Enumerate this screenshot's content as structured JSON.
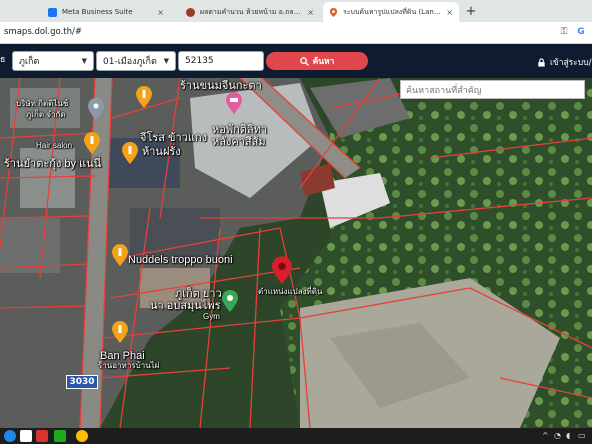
{
  "browser": {
    "tabs": [
      {
        "title": "Meta Business Suite",
        "active": false,
        "favicon_color": "#1877f2"
      },
      {
        "title": "ผลตามคำนวน ห้วยหน้าม อ.ถลาง จ.ภูเก็ต",
        "active": false,
        "favicon_color": "#9b3b2a"
      },
      {
        "title": "ระบบค้นหารูปแปลงที่ดิน (LandsMaps)",
        "active": true,
        "favicon_color": "#e05a2b"
      }
    ],
    "new_tab_label": "+",
    "close_glyph": "×",
    "url": "smaps.dol.go.th/#",
    "address_icons": [
      "key-icon",
      "google-icon"
    ]
  },
  "toolbar": {
    "left_edge_text": "ัธ",
    "province_select": "ภูเก็ต",
    "district_select": "01-เมืองภูเก็ต",
    "parcel_number": "52135",
    "search_button": "ค้นหา",
    "login_label": "เข้าสู่ระบบ/ล"
  },
  "map": {
    "search_placeholder": "ค้นหาสถานที่สำคัญ",
    "road_number": "3030",
    "labels": {
      "shop_top": "ร้านขนมจีนกะตา",
      "company": "บริษัท กิตติไนช์",
      "company2": "ภูเก็ต จำกัด",
      "hair_salon": "Hair salon",
      "school": "หอพักติลิทา",
      "school2": "หลังคาสีส้ม",
      "jeros": "จีโรส ข้าวแกง",
      "jeros2": "ห้านฝรั่ง",
      "yaktua": "ร้านยำตะกุ้ง by แนนี่",
      "nuddels": "Nuddels troppo buoni",
      "phuket_gym": "ภูเก็ต ยาว",
      "phuket_gym2": "นา อบสมุนไพร",
      "gym": "Gym",
      "parcel": "ตำแหน่งแปลงที่ดิน",
      "ban_phai": "Ban Phai",
      "ban_phai2": "ร้านอาหารบ้านไผ่"
    }
  },
  "taskbar": {
    "apps": [
      "edge-icon",
      "wps-icon",
      "wechat-icon",
      "chrome-icon"
    ],
    "tray": [
      "wifi-icon",
      "volume-icon",
      "battery-icon"
    ]
  },
  "colors": {
    "app_bar": "#0f1b2e",
    "search_button": "#e0464c",
    "parcel_lines": "#e6413b",
    "poi_pin": "#f3a21a",
    "parcel_pin": "#d81e2b"
  }
}
